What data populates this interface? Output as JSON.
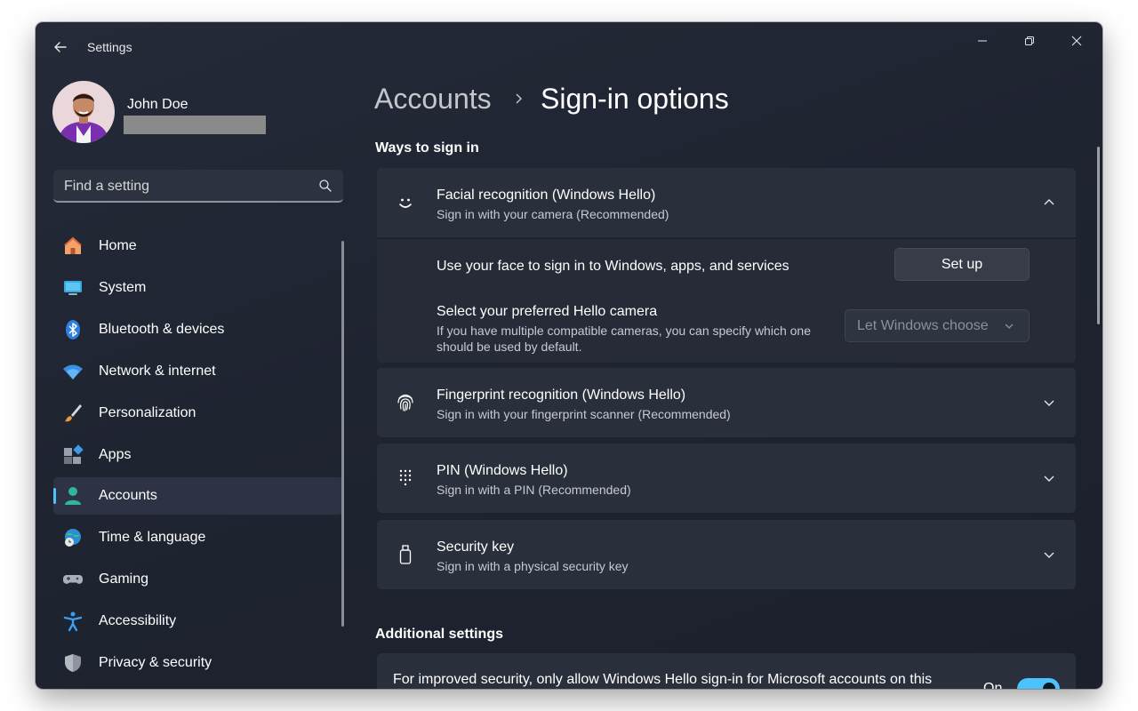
{
  "app": {
    "title": "Settings"
  },
  "profile": {
    "name": "John Doe"
  },
  "search": {
    "placeholder": "Find a setting"
  },
  "nav": {
    "items": [
      {
        "label": "Home",
        "icon": "home-icon"
      },
      {
        "label": "System",
        "icon": "system-icon"
      },
      {
        "label": "Bluetooth & devices",
        "icon": "bluetooth-icon"
      },
      {
        "label": "Network & internet",
        "icon": "wifi-icon"
      },
      {
        "label": "Personalization",
        "icon": "brush-icon"
      },
      {
        "label": "Apps",
        "icon": "apps-icon"
      },
      {
        "label": "Accounts",
        "icon": "accounts-icon",
        "active": true
      },
      {
        "label": "Time & language",
        "icon": "globe-clock-icon"
      },
      {
        "label": "Gaming",
        "icon": "gamepad-icon"
      },
      {
        "label": "Accessibility",
        "icon": "accessibility-icon"
      },
      {
        "label": "Privacy & security",
        "icon": "shield-icon"
      }
    ]
  },
  "breadcrumb": {
    "parent": "Accounts",
    "current": "Sign-in options"
  },
  "ways": {
    "heading": "Ways to sign in",
    "facial": {
      "title": "Facial recognition (Windows Hello)",
      "subtitle": "Sign in with your camera (Recommended)",
      "expanded": true,
      "face_label": "Use your face to sign in to Windows, apps, and services",
      "setup_label": "Set up",
      "camera_title": "Select your preferred Hello camera",
      "camera_desc": "If you have multiple compatible cameras, you can specify which one should be used by default.",
      "camera_value": "Let Windows choose"
    },
    "fingerprint": {
      "title": "Fingerprint recognition (Windows Hello)",
      "subtitle": "Sign in with your fingerprint scanner (Recommended)"
    },
    "pin": {
      "title": "PIN (Windows Hello)",
      "subtitle": "Sign in with a PIN (Recommended)"
    },
    "security_key": {
      "title": "Security key",
      "subtitle": "Sign in with a physical security key"
    }
  },
  "additional": {
    "heading": "Additional settings",
    "hello_only_label": "For improved security, only allow Windows Hello sign-in for Microsoft accounts on this",
    "toggle_state": "On"
  },
  "colors": {
    "accent": "#4cc2ff",
    "window_bg": "#1f2431",
    "card_bg": "#2a2f3c"
  }
}
